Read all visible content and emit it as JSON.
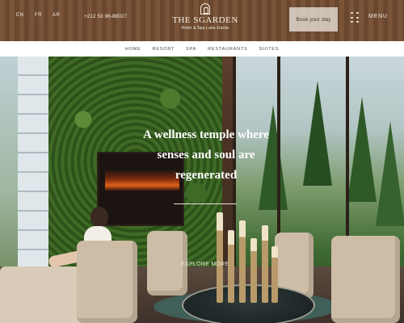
{
  "header": {
    "languages": [
      "EN",
      "FR",
      "AR"
    ],
    "phone": "+212 53 96-88027",
    "logo_name": "THE SGARDEN",
    "logo_subtitle": "Hotel & Spa Lake Garda",
    "book_label": "Book your stay",
    "menu_label": "MENU"
  },
  "nav": {
    "items": [
      "HOME",
      "RESORT",
      "SPA",
      "RESTAURANTS",
      "SUITES"
    ]
  },
  "hero": {
    "headline": "A wellness temple where senses and soul are regenerated",
    "cta": "EXPLORE MORE"
  },
  "colors": {
    "nav_background": "#ffffff",
    "book_button": "#ded6cd",
    "header_text": "#f3ece3"
  },
  "icons": [
    "logo-tower-icon",
    "grid-menu-icon"
  ]
}
